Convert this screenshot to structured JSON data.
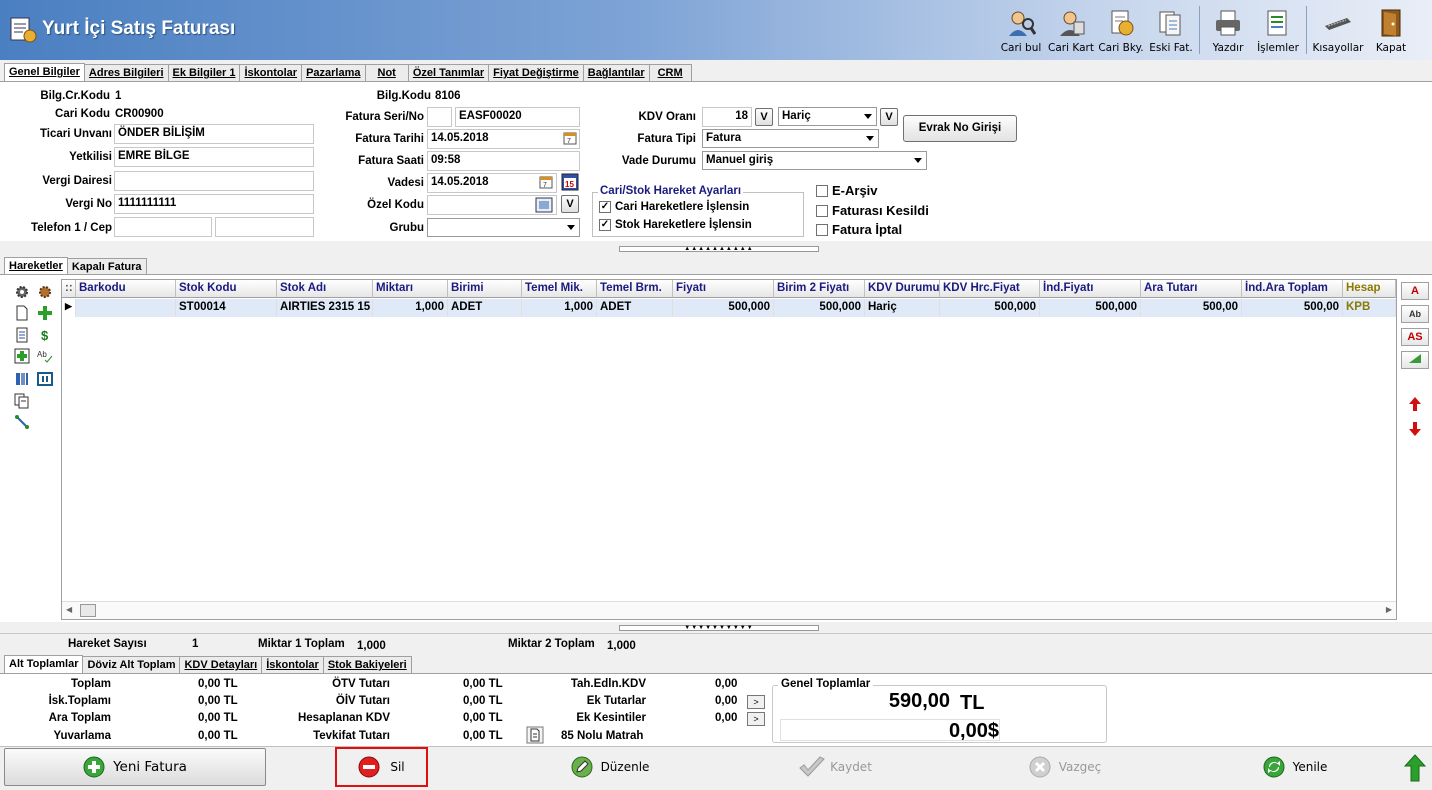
{
  "app": {
    "title": "Yurt İçi Satış Faturası"
  },
  "toolbar": [
    {
      "label": "Cari bul",
      "icon": "search-person-icon"
    },
    {
      "label": "Cari Kart",
      "icon": "card-person-icon"
    },
    {
      "label": "Cari Bky.",
      "icon": "balance-icon"
    },
    {
      "label": "Eski Fat.",
      "icon": "old-invoice-icon"
    },
    {
      "label": "Yazdır",
      "icon": "printer-icon"
    },
    {
      "label": "İşlemler",
      "icon": "operations-icon"
    },
    {
      "label": "Kısayollar",
      "icon": "keyboard-icon"
    },
    {
      "label": "Kapat",
      "icon": "exit-door-icon"
    }
  ],
  "main_tabs": [
    "Genel Bilgiler",
    "Adres Bilgileri",
    "Ek Bilgiler 1",
    "İskontolar",
    "Pazarlama",
    "Not",
    "Özel Tanımlar",
    "Fiyat Değiştirme",
    "Bağlantılar",
    "CRM"
  ],
  "general": {
    "bilg_cr_kodu_label": "Bilg.Cr.Kodu",
    "bilg_cr_kodu": "1",
    "cari_kodu_label": "Cari Kodu",
    "cari_kodu": "CR00900",
    "ticari_unvani_label": "Ticari Unvanı",
    "ticari_unvani": "ÖNDER BİLİŞİM",
    "yetkilisi_label": "Yetkilisi",
    "yetkilisi": "EMRE BİLGE",
    "vergi_dairesi_label": "Vergi Dairesi",
    "vergi_dairesi": "",
    "vergi_no_label": "Vergi No",
    "vergi_no": "1111111111",
    "telefon_label": "Telefon 1 / Cep",
    "telefon": "",
    "cep": "",
    "bilg_kodu_label": "Bilg.Kodu",
    "bilg_kodu": "8106",
    "fatura_seri_label": "Fatura Seri/No",
    "fatura_seri": "",
    "fatura_no": "EASF00020",
    "fatura_tarihi_label": "Fatura Tarihi",
    "fatura_tarihi": "14.05.2018",
    "fatura_saati_label": "Fatura Saati",
    "fatura_saati": "09:58",
    "vadesi_label": "Vadesi",
    "vadesi": "14.05.2018",
    "ozel_kodu_label": "Özel Kodu",
    "ozel_kodu": "",
    "grubu_label": "Grubu",
    "grubu": "",
    "kdv_orani_label": "KDV Oranı",
    "kdv_orani": "18",
    "kdv_mode": "Hariç",
    "fatura_tipi_label": "Fatura Tipi",
    "fatura_tipi": "Fatura",
    "vade_durumu_label": "Vade Durumu",
    "vade_durumu": "Manuel giriş",
    "evrak_button": "Evrak No Girişi",
    "v_button": "V",
    "hareket_group_title": "Cari/Stok Hareket Ayarları",
    "cari_hareket": "Cari Hareketlere İşlensin",
    "stok_hareket": "Stok Hareketlere İşlensin",
    "e_arsiv": "E-Arşiv",
    "faturasi_kesildi": "Faturası Kesildi",
    "fatura_iptal": "Fatura İptal"
  },
  "grid_tabs": [
    "Hareketler",
    "Kapalı Fatura"
  ],
  "grid": {
    "columns": [
      "Barkodu",
      "Stok Kodu",
      "Stok Adı",
      "Miktarı",
      "Birimi",
      "Temel Mik.",
      "Temel Brm.",
      "Fiyatı",
      "Birim 2 Fiyatı",
      "KDV Durumu",
      "KDV Hrc.Fiyat",
      "İnd.Fiyatı",
      "Ara Tutarı",
      "İnd.Ara Toplam",
      "Hesap"
    ],
    "rows": [
      [
        "",
        "ST00014",
        "AIRTIES 2315 15",
        "1,000",
        "ADET",
        "1,000",
        "ADET",
        "500,000",
        "500,000",
        "Hariç",
        "500,000",
        "500,000",
        "500,00",
        "500,00",
        "KPB"
      ]
    ]
  },
  "right_buttons": [
    "A",
    "Ab",
    "AS"
  ],
  "summary": {
    "hareket_sayisi_label": "Hareket Sayısı",
    "hareket_sayisi": "1",
    "miktar1_label": "Miktar 1 Toplam",
    "miktar1": "1,000",
    "miktar2_label": "Miktar 2 Toplam",
    "miktar2": "1,000"
  },
  "bottom_tabs": [
    "Alt Toplamlar",
    "Döviz Alt Toplam",
    "KDV Detayları",
    "İskontolar",
    "Stok Bakiyeleri"
  ],
  "totals": {
    "toplam_label": "Toplam",
    "toplam": "0,00 TL",
    "isk_label": "İsk.Toplamı",
    "isk": "0,00 TL",
    "ara_label": "Ara Toplam",
    "ara": "0,00 TL",
    "yuv_label": "Yuvarlama",
    "yuv": "0,00 TL",
    "otv_label": "ÖTV Tutarı",
    "otv": "0,00 TL",
    "oiv_label": "ÖİV Tutarı",
    "oiv": "0,00 TL",
    "hkdv_label": "Hesaplanan KDV",
    "hkdv": "0,00 TL",
    "tevkifat_label": "Tevkifat Tutarı",
    "tevkifat": "0,00 TL",
    "tah_label": "Tah.Edln.KDV",
    "tah": "0,00",
    "ektutar_label": "Ek Tutarlar",
    "ektutar": "0,00",
    "ekkes_label": "Ek Kesintiler",
    "ekkes": "0,00",
    "matrah_label": "85 Nolu Matrah",
    "genel_label": "Genel Toplamlar",
    "genel": "590,00",
    "genel_cur": "TL",
    "genel2": "0,00$"
  },
  "actions": {
    "yeni": "Yeni Fatura",
    "sil": "Sil",
    "duzenle": "Düzenle",
    "kaydet": "Kaydet",
    "vazgec": "Vazgeç",
    "yenile": "Yenile"
  }
}
